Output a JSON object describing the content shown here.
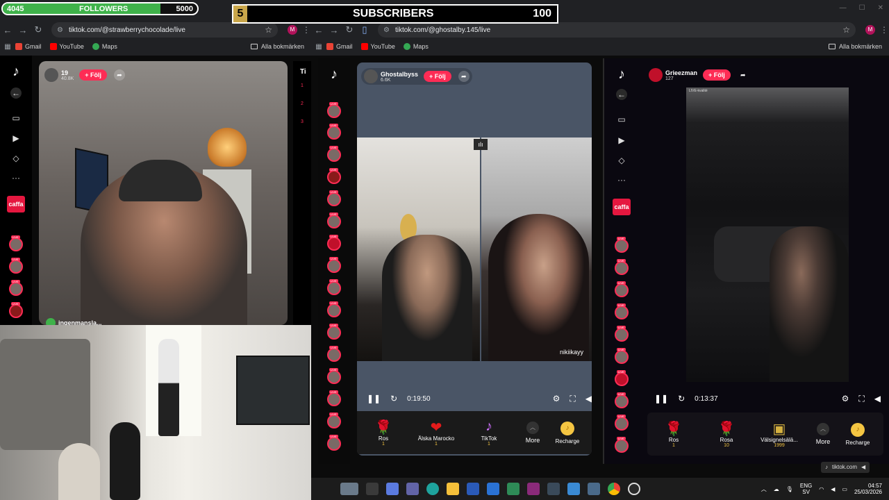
{
  "overlay": {
    "followers_current": "4045",
    "followers_label": "FOLLOWERS",
    "followers_goal": "5000",
    "followers_progress": 0.809,
    "subs_current": "5",
    "subs_label": "SUBSCRIBERS",
    "subs_goal": "100"
  },
  "left_browser": {
    "url": "tiktok.com/@strawberrychocolade/live",
    "profile_initial": "M",
    "bookmarks": [
      "Gmail",
      "YouTube",
      "Maps"
    ],
    "bookmarks_folder": "Alla bokmärken"
  },
  "right_browser": {
    "url": "tiktok.com/@ghostalby.145/live",
    "profile_initial": "M",
    "bookmarks": [
      "Gmail",
      "YouTube",
      "Maps"
    ],
    "bookmarks_folder": "Alla bokmärken"
  },
  "left_stream": {
    "name": "19",
    "likes": "40.8K",
    "follow": "+ Följ",
    "comment_user": "ingenmansla...",
    "side_label": "caffa",
    "peek_title": "Ti",
    "peek_numbers": [
      "1",
      "2",
      "3"
    ]
  },
  "mid_stream": {
    "name": "Ghostalbyss",
    "likes": "6.6K",
    "follow": "+ Följ",
    "guest_name": "nikiikayy",
    "time": "0:19:50",
    "gifts": [
      {
        "name": "Ros",
        "cost": "1",
        "icon": "🌹"
      },
      {
        "name": "Älska Marocko",
        "cost": "1",
        "icon": "❤"
      },
      {
        "name": "TikTok",
        "cost": "1",
        "icon": "♪"
      }
    ],
    "more": "More",
    "recharge": "Recharge"
  },
  "right_stream": {
    "name": "Grieezman",
    "likes": "127",
    "follow": "+ Följ",
    "time": "0:13:37",
    "side_label": "caffa",
    "live_label": "LIVE-kvalité",
    "gifts": [
      {
        "name": "Ros",
        "cost": "1",
        "icon": "🌹"
      },
      {
        "name": "Rosa",
        "cost": "10",
        "icon": "🌹"
      },
      {
        "name": "Välsignelsälä...",
        "cost": "1999",
        "icon": "▣"
      }
    ],
    "more": "More",
    "recharge": "Recharge",
    "status_url": "tiktok.com"
  },
  "taskbar": {
    "lang": "ENG",
    "lang_sub": "SV",
    "time": "04:57",
    "date": "25/03/2026"
  },
  "colors": {
    "tiktok_red": "#fe2c55",
    "followers_green": "#3fb24a",
    "subs_gold": "#c9a64a"
  }
}
